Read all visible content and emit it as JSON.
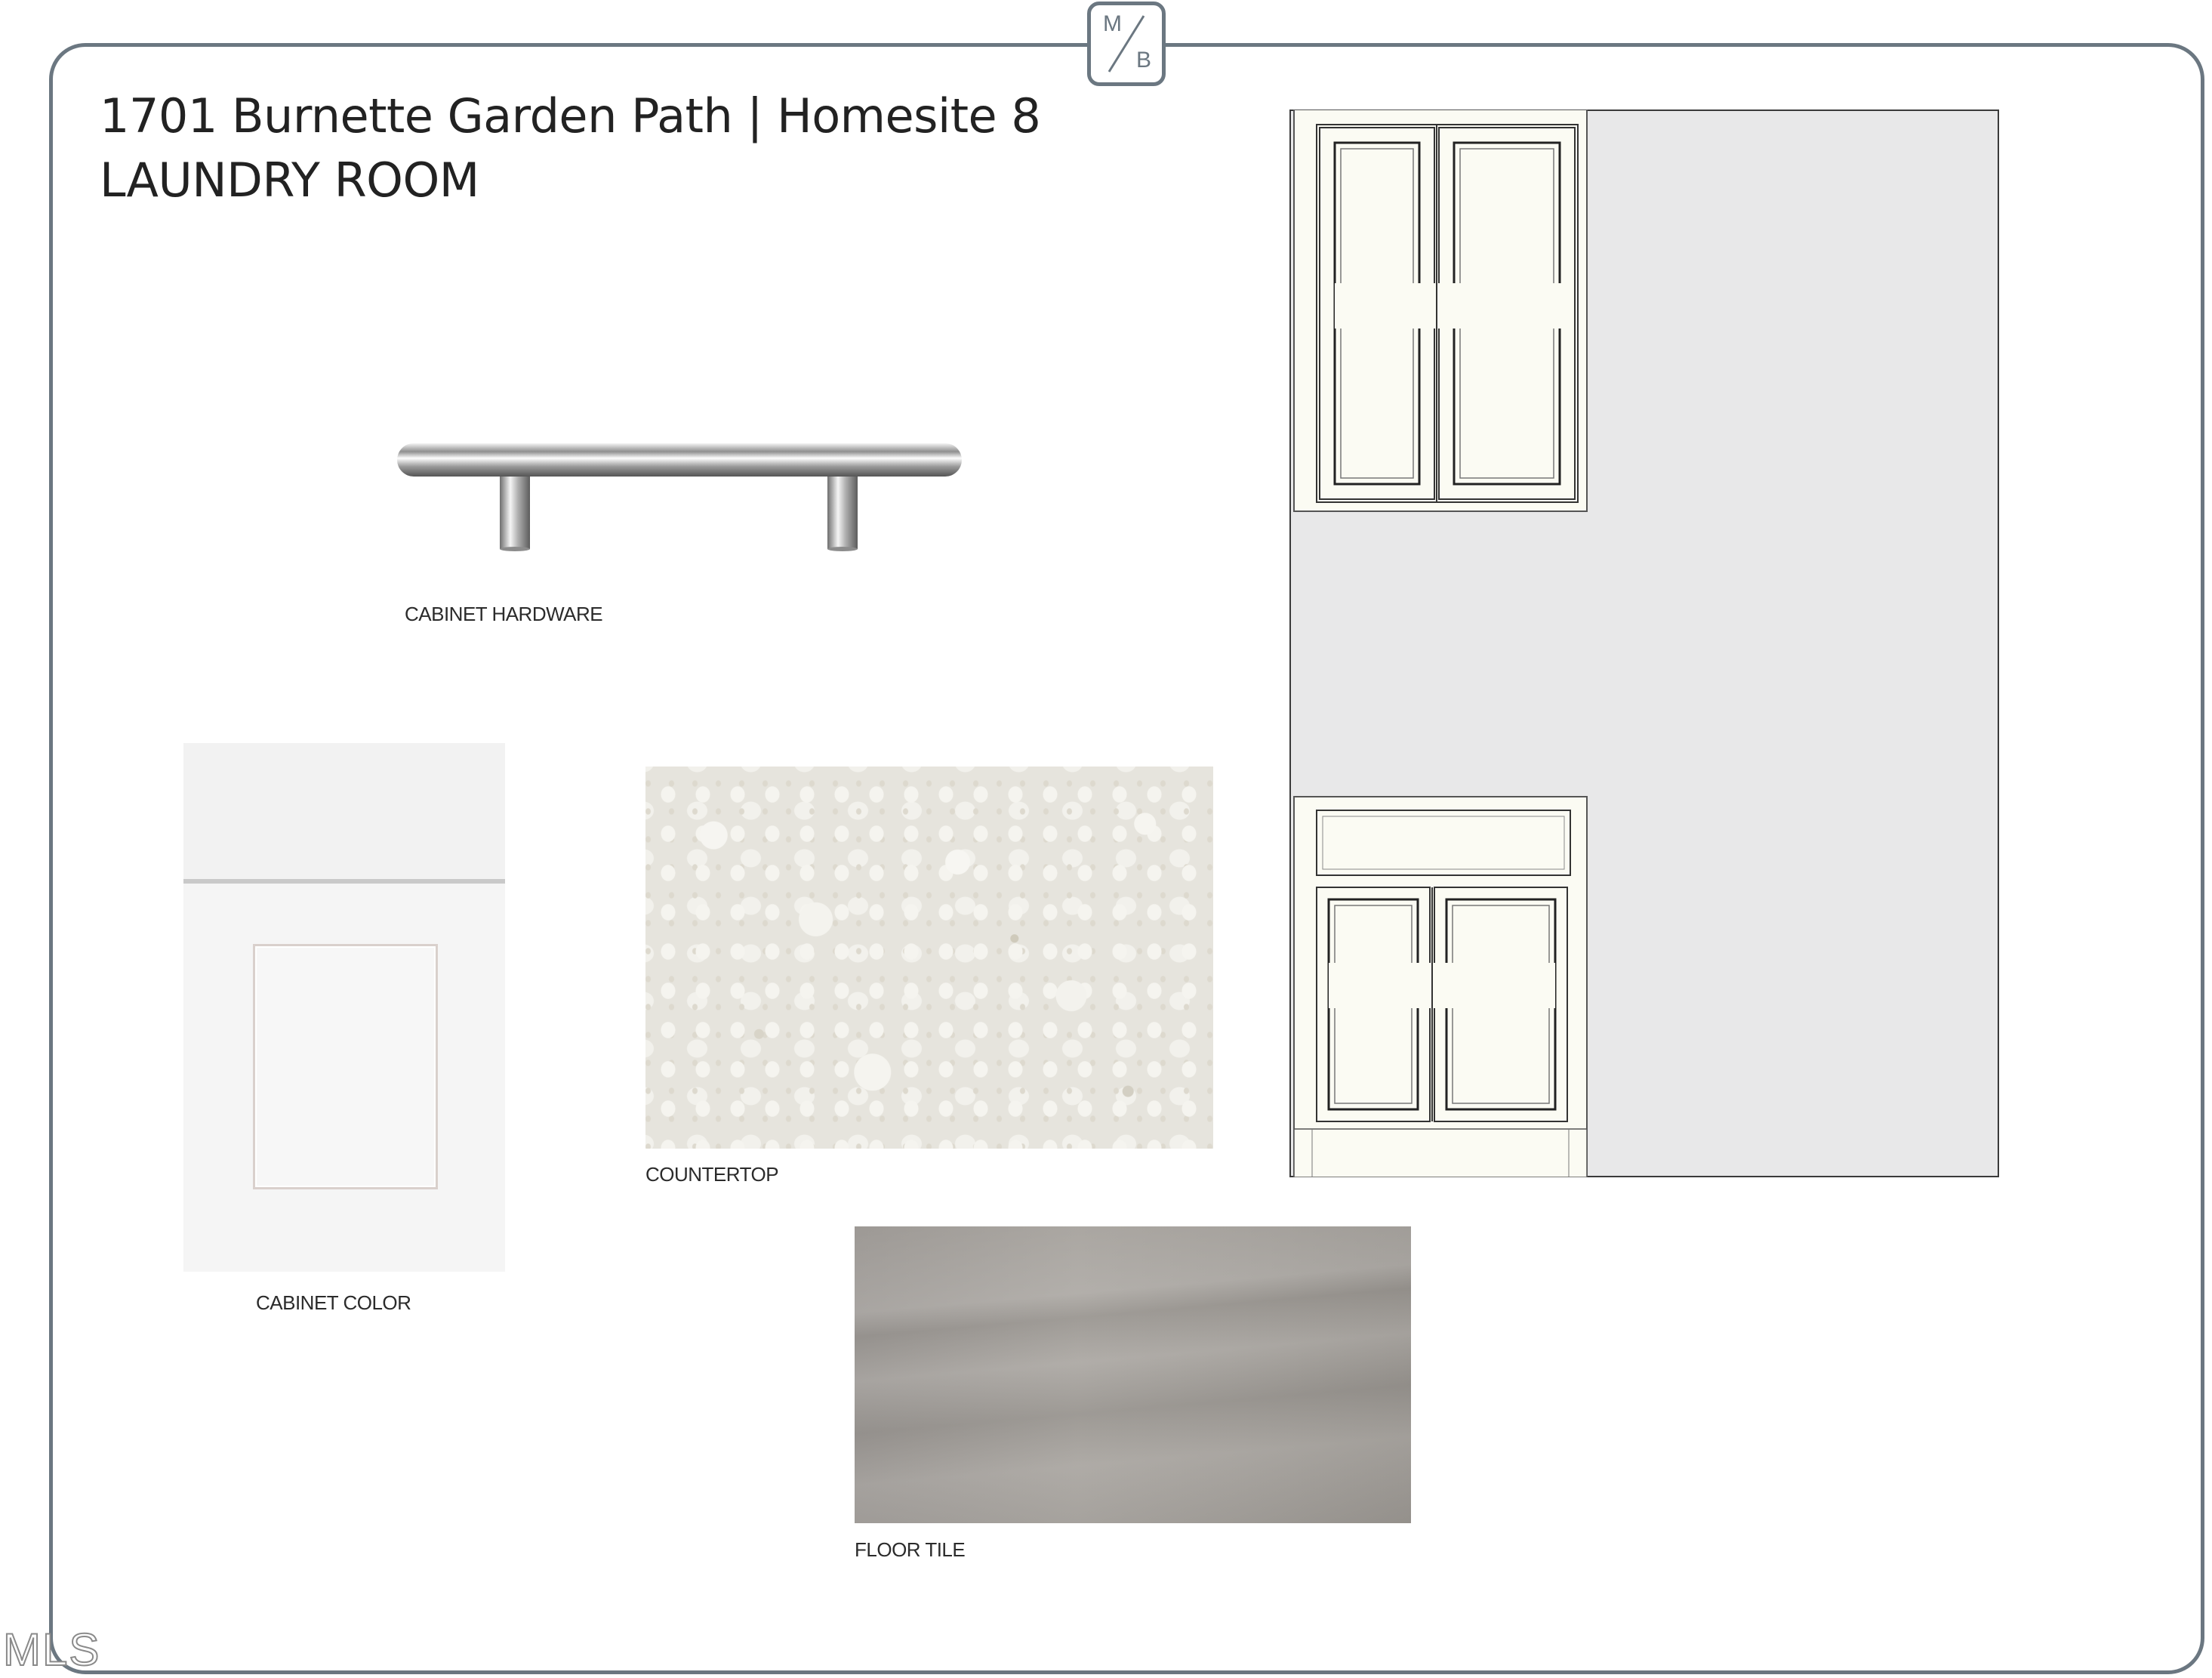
{
  "header": {
    "title": "1701 Burnette Garden Path | Homesite 8",
    "subtitle": "LAUNDRY ROOM"
  },
  "logo": {
    "top_letter": "M",
    "bottom_letter": "B"
  },
  "selections": {
    "hardware_label": "CABINET HARDWARE",
    "cabinet_color_label": "CABINET COLOR",
    "countertop_label": "COUNTERTOP",
    "floor_tile_label": "FLOOR TILE"
  },
  "watermark": {
    "text": "MLS"
  },
  "colors": {
    "frame": "#6b7781",
    "elevation_background": "#e8e8e9",
    "cabinet_fill": "#fbfbf3"
  }
}
